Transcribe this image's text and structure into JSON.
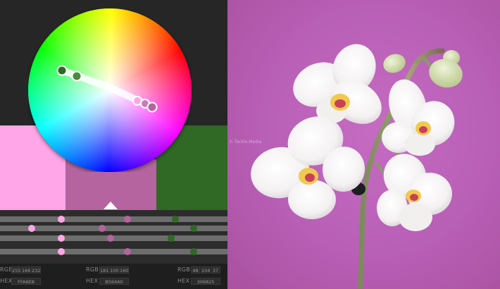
{
  "palette": {
    "swatches": [
      {
        "name": "swatch-1",
        "color": "#FFA6E8"
      },
      {
        "name": "swatch-2",
        "color": "#B564A0"
      },
      {
        "name": "swatch-3",
        "color": "#306825"
      }
    ],
    "wheel_markers_color_1": "#306825",
    "wheel_markers_color_2": "#FFA6E8"
  },
  "values": {
    "c1": {
      "rgb_label": "RGB",
      "r": "255",
      "g": "166",
      "b": "232",
      "hex_label": "HEX",
      "hex": "FFA6E8"
    },
    "c2": {
      "rgb_label": "RGB",
      "r": "181",
      "g": "100",
      "b": "160",
      "hex_label": "HEX",
      "hex": "B564A0"
    },
    "c3": {
      "rgb_label": "RGB",
      "r": "48",
      "g": "104",
      "b": "37",
      "hex_label": "HEX",
      "hex": "306825"
    }
  },
  "photo": {
    "watermark": "© Tackle Media",
    "background_color": "#B85FB6"
  }
}
